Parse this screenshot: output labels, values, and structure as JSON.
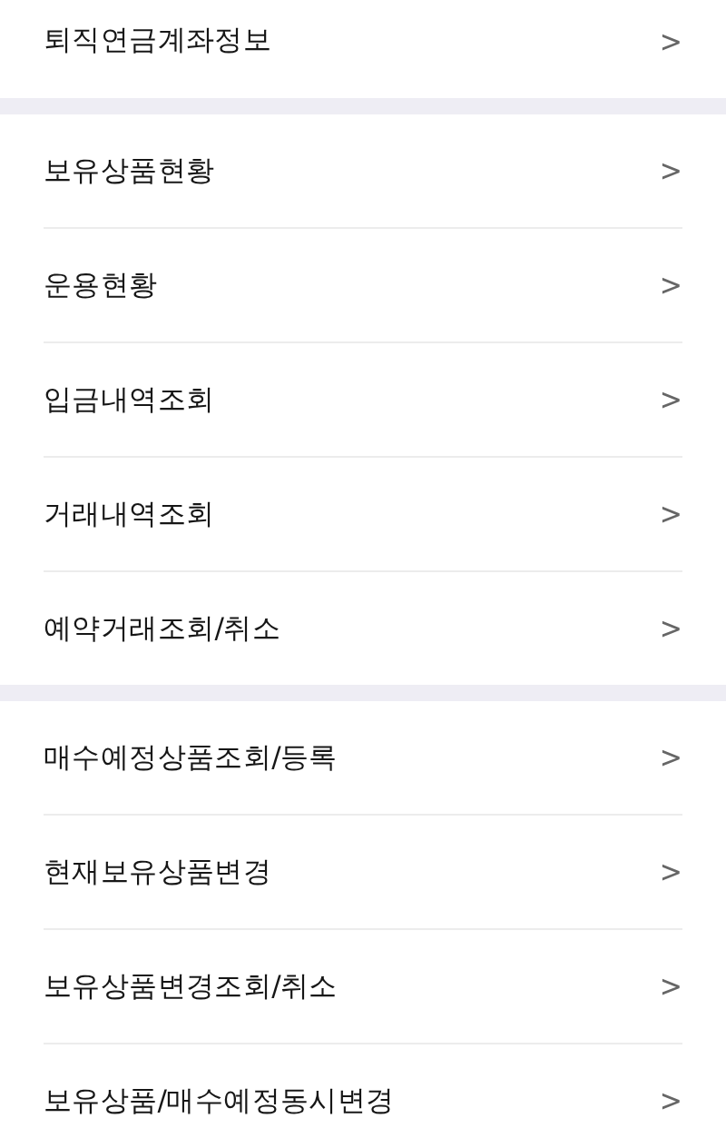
{
  "sections": [
    {
      "items": [
        {
          "label": "퇴직연금계좌정보",
          "chevron": ">"
        }
      ]
    },
    {
      "items": [
        {
          "label": "보유상품현황",
          "chevron": ">"
        },
        {
          "label": "운용현황",
          "chevron": ">"
        },
        {
          "label": "입금내역조회",
          "chevron": ">"
        },
        {
          "label": "거래내역조회",
          "chevron": ">"
        },
        {
          "label": "예약거래조회/취소",
          "chevron": ">"
        }
      ]
    },
    {
      "items": [
        {
          "label": "매수예정상품조회/등록",
          "chevron": ">"
        },
        {
          "label": "현재보유상품변경",
          "chevron": ">"
        },
        {
          "label": "보유상품변경조회/취소",
          "chevron": ">"
        },
        {
          "label": "보유상품/매수예정동시변경",
          "chevron": ">"
        }
      ]
    }
  ]
}
